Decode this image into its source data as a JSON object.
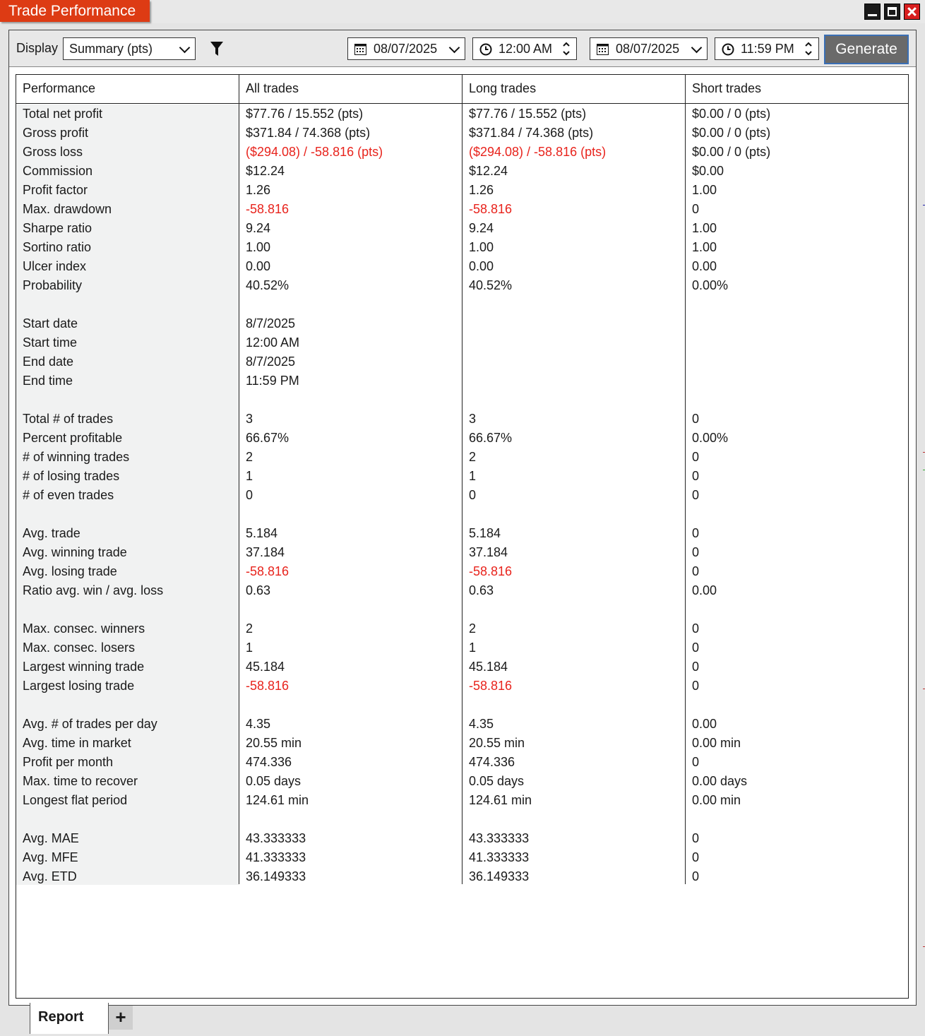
{
  "window": {
    "title": "Trade Performance"
  },
  "toolbar": {
    "display_label": "Display",
    "display_value": "Summary (pts)",
    "start_date": "08/07/2025",
    "start_time": "12:00 AM",
    "end_date": "08/07/2025",
    "end_time": "11:59 PM",
    "generate_label": "Generate"
  },
  "table": {
    "headers": [
      "Performance",
      "All trades",
      "Long trades",
      "Short trades"
    ],
    "rows": [
      {
        "label": "Total net profit",
        "all": "$77.76 / 15.552 (pts)",
        "long": "$77.76 / 15.552 (pts)",
        "short": "$0.00 / 0 (pts)"
      },
      {
        "label": "Gross profit",
        "all": "$371.84 / 74.368 (pts)",
        "long": "$371.84 / 74.368 (pts)",
        "short": "$0.00 / 0 (pts)"
      },
      {
        "label": "Gross loss",
        "all": "($294.08) / -58.816 (pts)",
        "long": "($294.08) / -58.816 (pts)",
        "short": "$0.00 / 0 (pts)",
        "neg": true
      },
      {
        "label": "Commission",
        "all": "$12.24",
        "long": "$12.24",
        "short": "$0.00"
      },
      {
        "label": "Profit factor",
        "all": "1.26",
        "long": "1.26",
        "short": "1.00"
      },
      {
        "label": "Max. drawdown",
        "all": "-58.816",
        "long": "-58.816",
        "short": "0",
        "neg": true
      },
      {
        "label": "Sharpe ratio",
        "all": "9.24",
        "long": "9.24",
        "short": "1.00"
      },
      {
        "label": "Sortino ratio",
        "all": "1.00",
        "long": "1.00",
        "short": "1.00"
      },
      {
        "label": "Ulcer index",
        "all": "0.00",
        "long": "0.00",
        "short": "0.00"
      },
      {
        "label": "Probability",
        "all": "40.52%",
        "long": "40.52%",
        "short": "0.00%"
      },
      {
        "blank": true
      },
      {
        "label": "Start date",
        "all": "8/7/2025",
        "long": "",
        "short": ""
      },
      {
        "label": "Start time",
        "all": "12:00 AM",
        "long": "",
        "short": ""
      },
      {
        "label": "End date",
        "all": "8/7/2025",
        "long": "",
        "short": ""
      },
      {
        "label": "End time",
        "all": "11:59 PM",
        "long": "",
        "short": ""
      },
      {
        "blank": true
      },
      {
        "label": "Total # of trades",
        "all": "3",
        "long": "3",
        "short": "0"
      },
      {
        "label": "Percent profitable",
        "all": "66.67%",
        "long": "66.67%",
        "short": "0.00%"
      },
      {
        "label": "# of winning trades",
        "all": "2",
        "long": "2",
        "short": "0"
      },
      {
        "label": "# of losing trades",
        "all": "1",
        "long": "1",
        "short": "0"
      },
      {
        "label": "# of even trades",
        "all": "0",
        "long": "0",
        "short": "0"
      },
      {
        "blank": true
      },
      {
        "label": "Avg. trade",
        "all": "5.184",
        "long": "5.184",
        "short": "0"
      },
      {
        "label": "Avg. winning trade",
        "all": "37.184",
        "long": "37.184",
        "short": "0"
      },
      {
        "label": "Avg. losing trade",
        "all": "-58.816",
        "long": "-58.816",
        "short": "0",
        "neg": true
      },
      {
        "label": "Ratio avg. win / avg. loss",
        "all": "0.63",
        "long": "0.63",
        "short": "0.00"
      },
      {
        "blank": true
      },
      {
        "label": "Max. consec. winners",
        "all": "2",
        "long": "2",
        "short": "0"
      },
      {
        "label": "Max. consec. losers",
        "all": "1",
        "long": "1",
        "short": "0"
      },
      {
        "label": "Largest winning trade",
        "all": "45.184",
        "long": "45.184",
        "short": "0"
      },
      {
        "label": "Largest losing trade",
        "all": "-58.816",
        "long": "-58.816",
        "short": "0",
        "neg": true
      },
      {
        "blank": true
      },
      {
        "label": "Avg. # of trades per day",
        "all": "4.35",
        "long": "4.35",
        "short": "0.00"
      },
      {
        "label": "Avg. time in market",
        "all": "20.55 min",
        "long": "20.55 min",
        "short": "0.00 min"
      },
      {
        "label": "Profit per month",
        "all": "474.336",
        "long": "474.336",
        "short": "0"
      },
      {
        "label": "Max. time to recover",
        "all": "0.05 days",
        "long": "0.05 days",
        "short": "0.00 days"
      },
      {
        "label": "Longest flat period",
        "all": "124.61 min",
        "long": "124.61 min",
        "short": "0.00 min"
      },
      {
        "blank": true
      },
      {
        "label": "Avg. MAE",
        "all": "43.333333",
        "long": "43.333333",
        "short": "0"
      },
      {
        "label": "Avg. MFE",
        "all": "41.333333",
        "long": "41.333333",
        "short": "0"
      },
      {
        "label": "Avg. ETD",
        "all": "36.149333",
        "long": "36.149333",
        "short": "0"
      }
    ]
  },
  "tabs": {
    "report_label": "Report",
    "add_label": "+"
  },
  "colors": {
    "title_bg": "#dd3b14",
    "negative": "#e8231c",
    "generate_bg": "#6a6a6a"
  }
}
